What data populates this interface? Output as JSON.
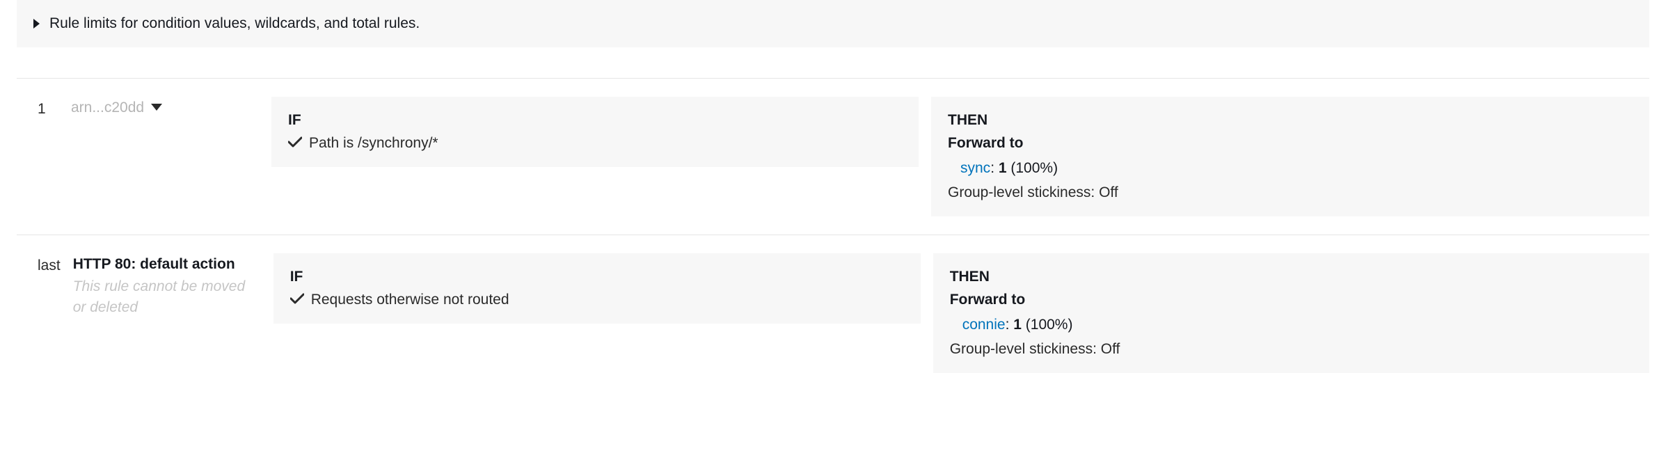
{
  "banner": {
    "text": "Rule limits for condition values, wildcards, and total rules."
  },
  "labels": {
    "if": "IF",
    "then": "THEN",
    "forward_to": "Forward to",
    "stickiness_prefix": "Group-level stickiness: "
  },
  "rules": [
    {
      "priority": "1",
      "arn": "arn...c20dd",
      "condition": "Path is /synchrony/*",
      "target": {
        "name": "sync",
        "weight": "1",
        "percent": "100%"
      },
      "stickiness": "Off"
    },
    {
      "priority": "last",
      "name": "HTTP 80: default action",
      "note": "This rule cannot be moved or deleted",
      "condition": "Requests otherwise not routed",
      "target": {
        "name": "connie",
        "weight": "1",
        "percent": "100%"
      },
      "stickiness": "Off"
    }
  ]
}
